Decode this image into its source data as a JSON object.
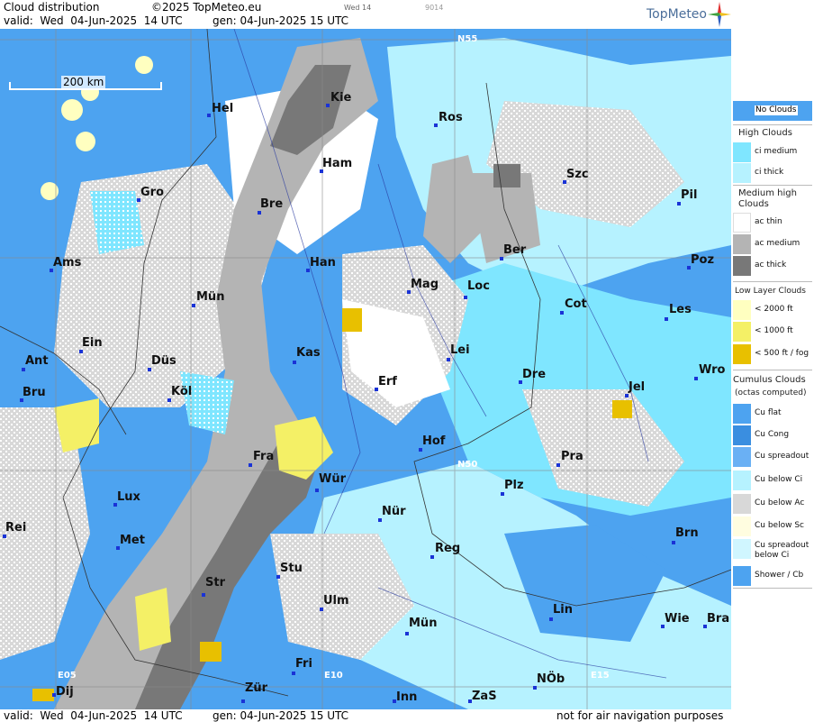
{
  "header": {
    "title": "Cloud distribution",
    "copyright": "©2025 TopMeteo.eu",
    "small_day": "Wed 14",
    "small_code": "9014",
    "valid": "valid:  Wed  04-Jun-2025  14 UTC",
    "gen": "gen: 04-Jun-2025 15 UTC",
    "logo": "TopMeteo"
  },
  "footer": {
    "valid": "valid:  Wed  04-Jun-2025  14 UTC",
    "gen": "gen: 04-Jun-2025 15 UTC",
    "note": "not for air navigation purposes"
  },
  "scale": {
    "label": "200 km"
  },
  "coords": [
    "N55",
    "N50",
    "E05",
    "E10",
    "E15"
  ],
  "cities": [
    "Hel",
    "Kie",
    "Ros",
    "Ham",
    "Szc",
    "Gro",
    "Bre",
    "Pil",
    "Ams",
    "Han",
    "Ber",
    "Poz",
    "Mün",
    "Mag",
    "Loc",
    "Cot",
    "Les",
    "Ein",
    "Kas",
    "Lei",
    "Ant",
    "Düs",
    "Dre",
    "Wro",
    "Bru",
    "Köl",
    "Erf",
    "Jel",
    "Hof",
    "Fra",
    "Pra",
    "Lux",
    "Wür",
    "Plz",
    "Rei",
    "Nür",
    "Met",
    "Reg",
    "Brn",
    "Stu",
    "Str",
    "Ulm",
    "Lin",
    "Wie",
    "Bra",
    "Mün",
    "Fri",
    "NÖb",
    "Dij",
    "Zür",
    "Inn",
    "ZaS"
  ],
  "legend": {
    "no_clouds": "No Clouds",
    "high": "High Clouds",
    "ci_medium": "ci medium",
    "ci_thick": "ci thick",
    "medium": "Medium high Clouds",
    "ac_thin": "ac thin",
    "ac_medium": "ac medium",
    "ac_thick": "ac thick",
    "low": "Low Layer Clouds",
    "low_2000": "< 2000 ft",
    "low_1000": "< 1000 ft",
    "low_500": "< 500 ft / fog",
    "cumulus": "Cumulus Clouds",
    "cumulus_sub": "(octas computed)",
    "cu_flat": "Cu flat",
    "cu_cong": "Cu Cong",
    "cu_spread": "Cu spreadout",
    "cu_ci": "Cu below Ci",
    "cu_ac": "Cu below Ac",
    "cu_sc": "Cu below Sc",
    "cu_spread_ci": "Cu spreadout below Ci",
    "shower": "Shower / Cb"
  },
  "colors": {
    "no_clouds": "#4da3f0",
    "ci_medium": "#7fe6ff",
    "ci_thick": "#b6f2ff",
    "ac_thin": "#ffffff",
    "ac_medium": "#b4b4b4",
    "ac_thick": "#787878",
    "low_2000": "#ffffc0",
    "low_1000": "#f4f066",
    "low_500": "#e8c000"
  }
}
